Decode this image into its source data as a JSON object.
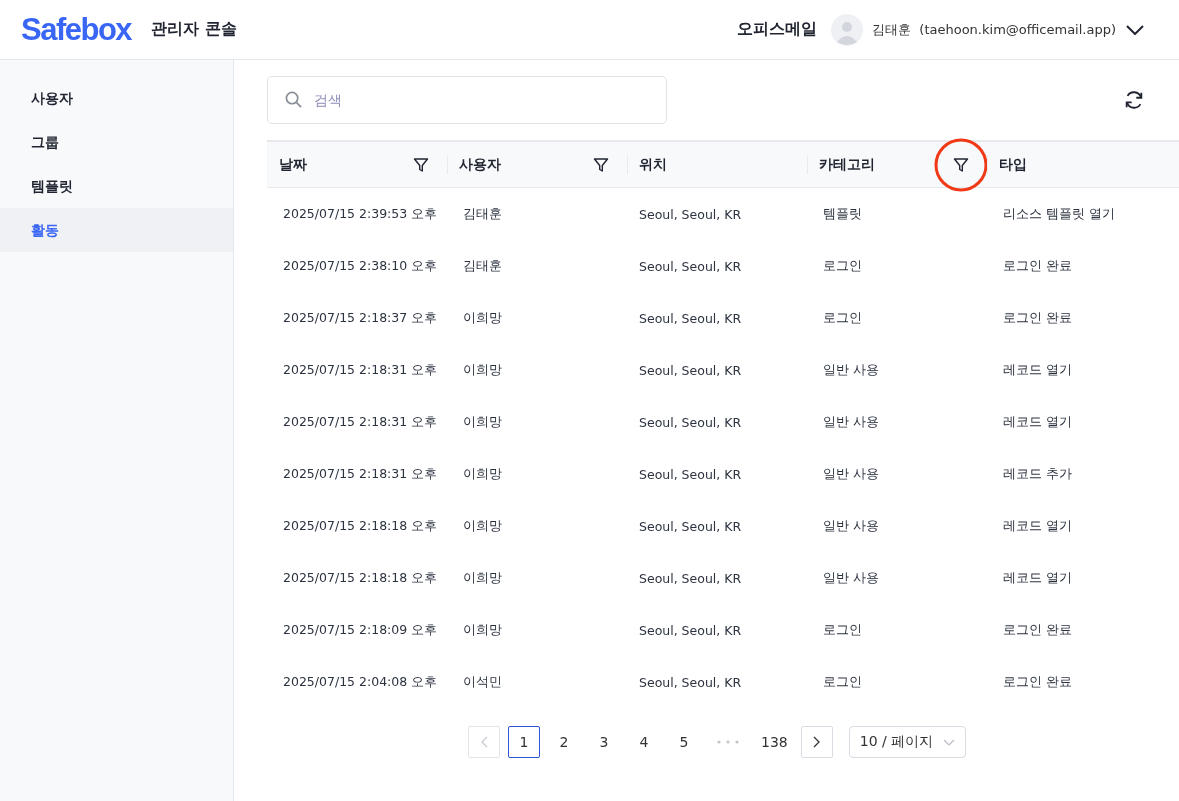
{
  "header": {
    "logo": "Safebox",
    "title": "관리자 콘솔",
    "org": "오피스메일",
    "user_name": "김태훈",
    "user_email": "(taehoon.kim@officemail.app)"
  },
  "sidebar": {
    "items": [
      {
        "label": "사용자",
        "selected": false
      },
      {
        "label": "그룹",
        "selected": false
      },
      {
        "label": "템플릿",
        "selected": false
      },
      {
        "label": "활동",
        "selected": true
      }
    ]
  },
  "search": {
    "placeholder": "검색"
  },
  "table": {
    "columns": [
      {
        "label": "날짜",
        "kind": "filterable"
      },
      {
        "label": "사용자",
        "kind": "filterable"
      },
      {
        "label": "위치",
        "kind": "plain"
      },
      {
        "label": "카테고리",
        "kind": "filterable",
        "highlighted": true
      },
      {
        "label": "타입",
        "kind": "plain"
      }
    ],
    "rows": [
      [
        "2025/07/15 2:39:53 오후",
        "김태훈",
        "Seoul, Seoul, KR",
        "템플릿",
        "리소스 템플릿 열기"
      ],
      [
        "2025/07/15 2:38:10 오후",
        "김태훈",
        "Seoul, Seoul, KR",
        "로그인",
        "로그인 완료"
      ],
      [
        "2025/07/15 2:18:37 오후",
        "이희망",
        "Seoul, Seoul, KR",
        "로그인",
        "로그인 완료"
      ],
      [
        "2025/07/15 2:18:31 오후",
        "이희망",
        "Seoul, Seoul, KR",
        "일반 사용",
        "레코드 열기"
      ],
      [
        "2025/07/15 2:18:31 오후",
        "이희망",
        "Seoul, Seoul, KR",
        "일반 사용",
        "레코드 열기"
      ],
      [
        "2025/07/15 2:18:31 오후",
        "이희망",
        "Seoul, Seoul, KR",
        "일반 사용",
        "레코드 추가"
      ],
      [
        "2025/07/15 2:18:18 오후",
        "이희망",
        "Seoul, Seoul, KR",
        "일반 사용",
        "레코드 열기"
      ],
      [
        "2025/07/15 2:18:18 오후",
        "이희망",
        "Seoul, Seoul, KR",
        "일반 사용",
        "레코드 열기"
      ],
      [
        "2025/07/15 2:18:09 오후",
        "이희망",
        "Seoul, Seoul, KR",
        "로그인",
        "로그인 완료"
      ],
      [
        "2025/07/15 2:04:08 오후",
        "이석민",
        "Seoul, Seoul, KR",
        "로그인",
        "로그인 완료"
      ]
    ]
  },
  "pagination": {
    "prev_disabled": true,
    "next_disabled": false,
    "items": [
      {
        "kind": "page",
        "label": "1",
        "selected": true
      },
      {
        "kind": "page",
        "label": "2",
        "selected": false
      },
      {
        "kind": "page",
        "label": "3",
        "selected": false
      },
      {
        "kind": "page",
        "label": "4",
        "selected": false
      },
      {
        "kind": "page",
        "label": "5",
        "selected": false
      },
      {
        "kind": "ellipsis"
      },
      {
        "kind": "page",
        "label": "138",
        "selected": false
      }
    ],
    "page_size": "10 / 페이지"
  }
}
